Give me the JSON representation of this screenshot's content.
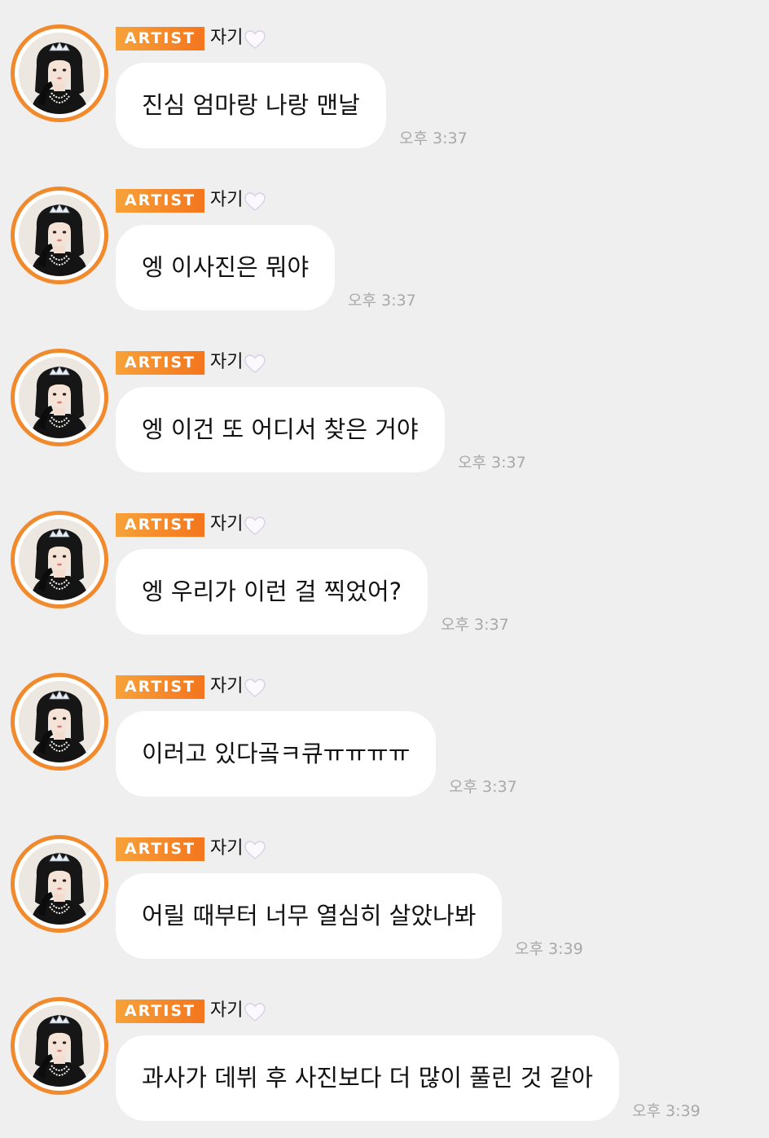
{
  "badge_label": "ARTIST",
  "icons": {
    "heart": "white-heart-icon",
    "avatar": "artist-avatar"
  },
  "colors": {
    "background": "#efefef",
    "badge_start": "#f7a23a",
    "badge_end": "#f4751d",
    "avatar_ring": "#f08a2c",
    "bubble": "#ffffff",
    "timestamp": "#a8a8a8"
  },
  "messages": [
    {
      "nickname": "자기",
      "text": "진심 엄마랑 나랑 맨날",
      "time": "오후 3:37"
    },
    {
      "nickname": "자기",
      "text": "엥 이사진은 뭐야",
      "time": "오후 3:37"
    },
    {
      "nickname": "자기",
      "text": "엥 이건 또 어디서 찾은 거야",
      "time": "오후 3:37"
    },
    {
      "nickname": "자기",
      "text": "엥 우리가 이런 걸 찍었어?",
      "time": "오후 3:37"
    },
    {
      "nickname": "자기",
      "text": "이러고 있다곸ㅋ큐ㅠㅠㅠㅠ",
      "time": "오후 3:37"
    },
    {
      "nickname": "자기",
      "text": "어릴 때부터 너무 열심히 살았나봐",
      "time": "오후 3:39"
    },
    {
      "nickname": "자기",
      "text": "과사가 데뷔 후 사진보다 더 많이 풀린 것 같아",
      "time": "오후 3:39"
    }
  ]
}
